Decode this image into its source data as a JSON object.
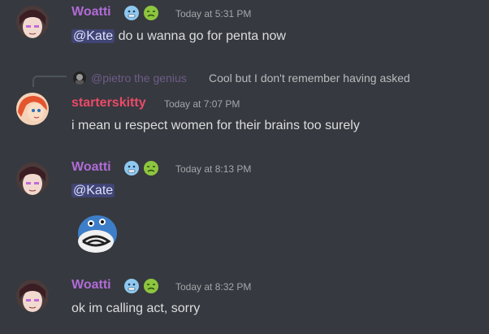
{
  "colors": {
    "background": "#36393f",
    "woatti_name": "#b06bd6",
    "starterskitty_name": "#eb4a68",
    "mention_bg": "#4b4f8a",
    "timestamp": "#a3a6aa",
    "text": "#dcddde"
  },
  "messages": [
    {
      "username": "Woatti",
      "timestamp": "Today at 5:31 PM",
      "mention": "@Kate",
      "text": " do u wanna go for penta now",
      "badges": [
        "cold-face-icon",
        "nauseated-face-icon"
      ]
    },
    {
      "reply": {
        "mention": "@pietro the genius",
        "text": "Cool but I don't remember having asked"
      },
      "username": "starterskitty",
      "timestamp": "Today at 7:07 PM",
      "text": "i mean u respect women for their brains too surely"
    },
    {
      "username": "Woatti",
      "timestamp": "Today at 8:13 PM",
      "mention": "@Kate",
      "sticker": "poliwag-sticker",
      "badges": [
        "cold-face-icon",
        "nauseated-face-icon"
      ]
    },
    {
      "username": "Woatti",
      "timestamp": "Today at 8:32 PM",
      "text": "ok im calling act, sorry",
      "badges": [
        "cold-face-icon",
        "nauseated-face-icon"
      ]
    }
  ]
}
